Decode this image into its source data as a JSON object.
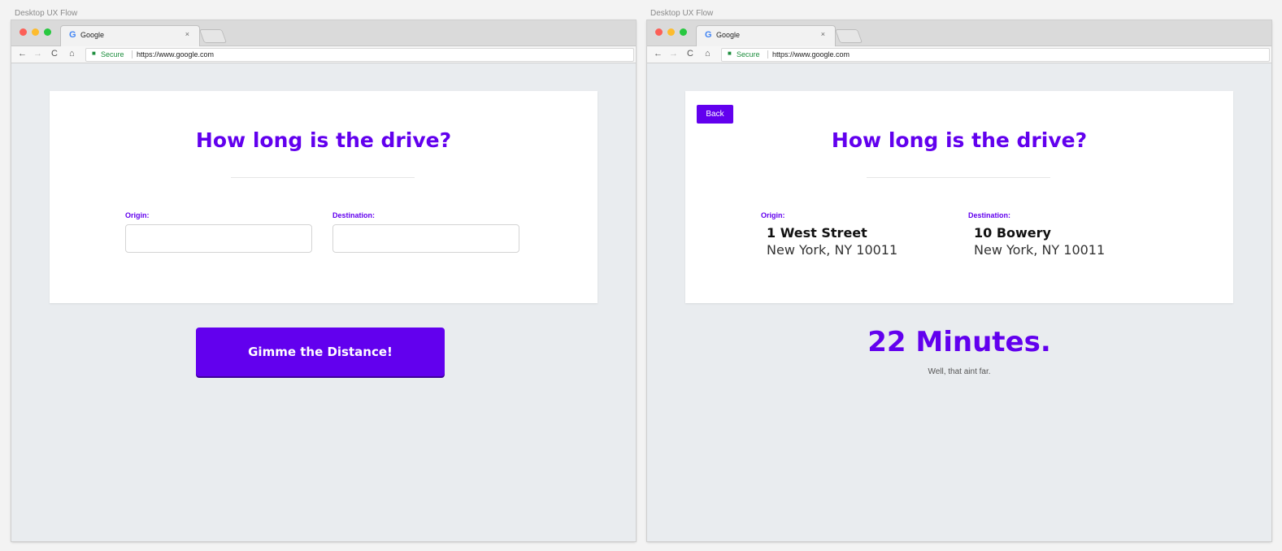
{
  "artboards": [
    {
      "label": "Desktop UX Flow"
    },
    {
      "label": "Desktop UX Flow"
    }
  ],
  "browser": {
    "tab_favicon": "G",
    "tab_title": "Google",
    "tab_close": "×",
    "back_icon": "←",
    "forward_icon": "→",
    "reload_icon": "C",
    "home_icon": "⌂",
    "lock_icon": "🔒",
    "secure_label": "Secure",
    "url": "https://www.google.com"
  },
  "form_screen": {
    "title": "How long is the drive?",
    "origin_label": "Origin:",
    "destination_label": "Destination:",
    "origin_value": "",
    "destination_value": "",
    "submit_label": "Gimme the Distance!"
  },
  "result_screen": {
    "back_label": "Back",
    "title": "How long is the drive?",
    "origin_label": "Origin:",
    "origin_line1": "1 West Street",
    "origin_line2": "New York, NY 10011",
    "destination_label": "Destination:",
    "destination_line1": "10 Bowery",
    "destination_line2": "New York, NY 10011",
    "result_value": "22 Minutes.",
    "result_sub": "Well, that aint far."
  },
  "colors": {
    "accent": "#6200ee",
    "page_bg": "#e9ecef",
    "card_bg": "#ffffff"
  }
}
